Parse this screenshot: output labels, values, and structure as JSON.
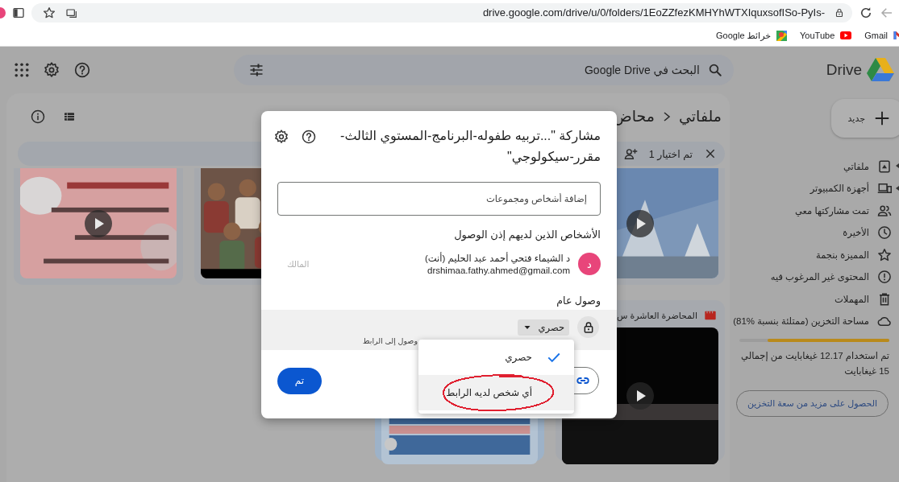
{
  "browser": {
    "url": "drive.google.com/drive/u/0/folders/1EoZZfezKMHYhWTXIquxsofISo-PyIs-",
    "bookmarks": [
      {
        "label": "Gmail",
        "kind": "gmail"
      },
      {
        "label": "YouTube",
        "kind": "youtube"
      },
      {
        "label": "خرائط Google",
        "kind": "maps"
      }
    ]
  },
  "drive": {
    "app_name": "Drive",
    "search": {
      "placeholder": "البحث في Google Drive"
    },
    "breadcrumb": [
      "ملفاتي",
      "محاض"
    ],
    "selection": {
      "count": "تم اختيار 1"
    },
    "files": [
      {
        "kind": "abstract",
        "play_button": true,
        "selected": false
      },
      {
        "kind": "crowd",
        "play_button": false,
        "selected": false
      },
      {
        "kind": "slide",
        "play_button": true,
        "selected": false
      },
      {
        "kind": "video",
        "title": "المحاضرة العاشرة س",
        "play_button": true,
        "selected": false
      },
      {
        "kind": "blue-slide",
        "play_button": false,
        "selected": true
      }
    ],
    "sidebar": {
      "new_button": "جديد",
      "items": [
        {
          "label": "ملفاتي",
          "kind": "drive",
          "expandable": true,
          "selected": false
        },
        {
          "label": "أجهزة الكمبيوتر",
          "kind": "computer",
          "expandable": true,
          "selected": false
        },
        {
          "label": "تمت مشاركتها معي",
          "kind": "shared",
          "expandable": false,
          "selected": false
        },
        {
          "label": "الأخيرة",
          "kind": "recent",
          "expandable": false,
          "selected": false
        },
        {
          "label": "المميزة بنجمة",
          "kind": "star",
          "expandable": false,
          "selected": false
        },
        {
          "label": "المحتوى غير المرغوب فيه",
          "kind": "spam",
          "expandable": false,
          "selected": false
        },
        {
          "label": "المهملات",
          "kind": "trash",
          "expandable": false,
          "selected": false
        },
        {
          "label": "مساحة التخزين (ممتلئة بنسبة %81)",
          "kind": "cloud",
          "expandable": false,
          "selected": false
        }
      ],
      "storage": {
        "level": 0.81,
        "usage": "تم استخدام 12.17 غيغابايت من إجمالي 15 غيغابايت",
        "button": "الحصول على مزيد من سعة التخزين"
      }
    }
  },
  "dialog": {
    "title": "مشاركة \"...تربيه طفوله-البرنامج-المستوي الثالث-مقرر-سيكولوجي\"",
    "add_people": {
      "placeholder": "إضافة أشخاص ومجموعات"
    },
    "people_heading": "الأشخاص الذين لديهم إذن الوصول",
    "people": [
      {
        "avatar": "د",
        "color": "#e8457a",
        "name": "د الشيماء فتحي أحمد عبد الحليم (أنت)",
        "email": "drshimaa.fathy.ahmed@gmail.com",
        "role": "المالك"
      }
    ],
    "general_access": {
      "heading": "وصول عام",
      "value": "حصري",
      "description": "وصول إلى الرابط"
    },
    "done_button": "تم",
    "access_menu": {
      "options": [
        {
          "label": "حصري",
          "selected": true,
          "hovered": false
        },
        {
          "label": "أي شخص لديه الرابط",
          "selected": false,
          "hovered": true
        }
      ]
    },
    "annotation": {
      "kind": "ellipse",
      "color": "#e02030"
    }
  }
}
